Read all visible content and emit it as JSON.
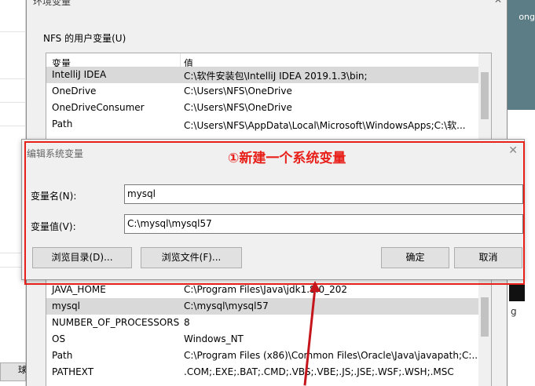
{
  "background": {
    "left_button_glyph": "球",
    "right_peek_text": "ong",
    "right_low_text": "g"
  },
  "env_window": {
    "title": "环境变量",
    "user_group_label": "NFS 的用户变量(U)",
    "columns": {
      "name": "变量",
      "value": "值"
    },
    "user_vars": [
      {
        "name": "IntelliJ IDEA",
        "value": "C:\\软件安装包\\IntelliJ IDEA 2019.1.3\\bin;",
        "selected": true
      },
      {
        "name": "OneDrive",
        "value": "C:\\Users\\NFS\\OneDrive",
        "selected": false
      },
      {
        "name": "OneDriveConsumer",
        "value": "C:\\Users\\NFS\\OneDrive",
        "selected": false
      },
      {
        "name": "Path",
        "value": "C:\\Users\\NFS\\AppData\\Local\\Microsoft\\WindowsApps;C:\\软...",
        "selected": false
      }
    ],
    "system_vars": [
      {
        "name": "JAVA_HOME",
        "value": "C:\\Program Files\\Java\\jdk1.8.0_202",
        "selected": false
      },
      {
        "name": "mysql",
        "value": "C:\\mysql\\mysql57",
        "selected": true
      },
      {
        "name": "NUMBER_OF_PROCESSORS",
        "value": "8",
        "selected": false
      },
      {
        "name": "OS",
        "value": "Windows_NT",
        "selected": false
      },
      {
        "name": "Path",
        "value": "C:\\Program Files (x86)\\Common Files\\Oracle\\Java\\javapath;C:...",
        "selected": false
      },
      {
        "name": "PATHEXT",
        "value": ".COM;.EXE;.BAT;.CMD;.VBS;.VBE;.JS;.JSE;.WSF;.WSH;.MSC",
        "selected": false
      }
    ]
  },
  "dialog": {
    "title": "编辑系统变量",
    "annotation": "①新建一个系统变量",
    "name_label": "变量名(N):",
    "name_value": "mysql",
    "value_label": "变量值(V):",
    "value_value": "C:\\mysql\\mysql57",
    "browse_dir_label": "浏览目录(D)...",
    "browse_file_label": "浏览文件(F)...",
    "ok_label": "确定",
    "cancel_label": "取消"
  },
  "colors": {
    "annotation_red": "#e8201a",
    "selection_gray": "#d9d9d9",
    "dialog_bg": "#f0f0f0"
  }
}
